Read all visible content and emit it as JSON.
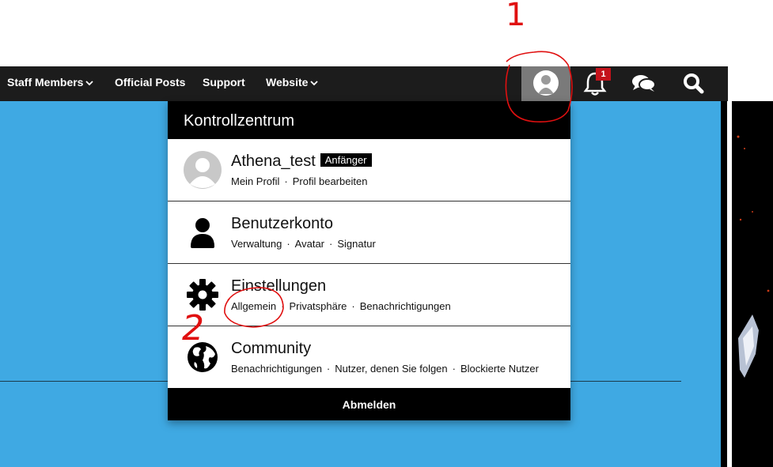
{
  "nav": {
    "items": [
      {
        "label": "Staff Members",
        "dropdown": true
      },
      {
        "label": "Official Posts",
        "dropdown": false
      },
      {
        "label": "Support",
        "dropdown": false
      },
      {
        "label": "Website",
        "dropdown": true
      }
    ],
    "notification_count": "1"
  },
  "panel": {
    "title": "Kontrollzentrum",
    "user": {
      "name": "Athena_test",
      "rank": "Anfänger",
      "links": [
        "Mein Profil",
        "Profil bearbeiten"
      ]
    },
    "sections": [
      {
        "title": "Benutzerkonto",
        "icon": "user-icon",
        "links": [
          "Verwaltung",
          "Avatar",
          "Signatur"
        ]
      },
      {
        "title": "Einstellungen",
        "icon": "gear-icon",
        "links": [
          "Allgemein",
          "Privatsphäre",
          "Benachrichtigungen"
        ]
      },
      {
        "title": "Community",
        "icon": "globe-icon",
        "links": [
          "Benachrichtigungen",
          "Nutzer, denen Sie folgen",
          "Blockierte Nutzer"
        ]
      }
    ],
    "logout_label": "Abmelden"
  },
  "annotations": {
    "marker_1": "1",
    "marker_2": "2"
  },
  "colors": {
    "navbar": "#1c1c1c",
    "page_background": "#3fa9e3",
    "badge": "#c4121b",
    "annotation": "#e01010"
  }
}
